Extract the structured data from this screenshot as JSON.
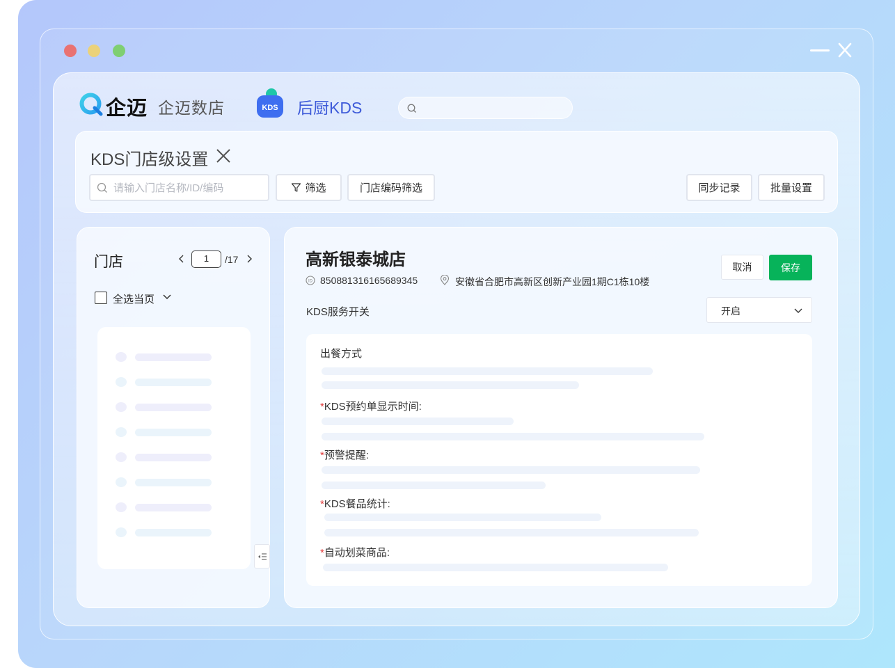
{
  "brand": {
    "name": "企迈",
    "product": "企迈数店",
    "kds_name": "后厨KDS",
    "kds_icon_text": "KDS"
  },
  "top_search": {
    "placeholder": ""
  },
  "header": {
    "title": "KDS门店级设置",
    "search_placeholder": "请输入门店名称/ID/编码",
    "filter_label": "筛选",
    "code_filter_label": "门店编码筛选",
    "sync_label": "同步记录",
    "batch_label": "批量设置"
  },
  "store_list": {
    "title": "门店",
    "page_current": "1",
    "page_total": "/17",
    "select_all_label": "全选当页"
  },
  "store_detail": {
    "name": "高新银泰城店",
    "id": "850881316165689345",
    "address": "安徽省合肥市高新区创新产业园1期C1栋10楼",
    "cancel_label": "取消",
    "save_label": "保存",
    "switch_label": "KDS服务开关",
    "switch_value": "开启",
    "settings": [
      {
        "label": "出餐方式",
        "required": false
      },
      {
        "label": "KDS预约单显示时间:",
        "required": true
      },
      {
        "label": "预警提醒:",
        "required": true
      },
      {
        "label": "KDS餐品统计:",
        "required": true
      },
      {
        "label": "自动划菜商品:",
        "required": true
      }
    ]
  },
  "colors": {
    "accent_green": "#07b35a",
    "kds_blue": "#3e5bd9",
    "required_red": "#e23b3b",
    "window_dot_red": "#e97272",
    "window_dot_yellow": "#ebd27a",
    "window_dot_green": "#7fcf72"
  }
}
